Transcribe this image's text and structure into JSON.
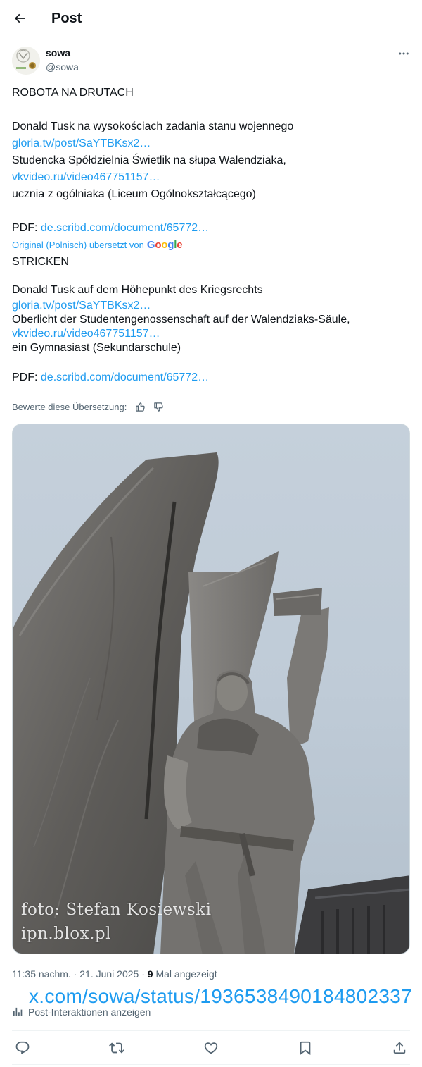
{
  "header": {
    "title": "Post"
  },
  "author": {
    "name": "sowa",
    "handle": "@sowa"
  },
  "post": {
    "original_title": "ROBOTA NA DRUTACH",
    "original_lines": [
      "Donald Tusk na wysokościach zadania stanu wojennego",
      "gloria.tv/post/SaYTBKsx2…",
      "Studencka Spółdzielnia Świetlik na słupa Walendziaka,",
      "vkvideo.ru/video467751157…",
      "ucznia z ogólniaka (Liceum Ogólnokształcącego)",
      "PDF: ",
      "de.scribd.com/document/65772…"
    ],
    "translated_by": "Original (Polnisch) übersetzt von",
    "google": [
      "G",
      "o",
      "o",
      "g",
      "l",
      "e"
    ],
    "translated_title": "STRICKEN",
    "translated_lines": [
      "Donald Tusk auf dem Höhepunkt des Kriegsrechts",
      "gloria.tv/post/SaYTBKsx2…",
      "Oberlicht der Studentengenossenschaft auf der Walendziaks-Säule,",
      "vkvideo.ru/video467751157…",
      "ein Gymnasiast (Sekundarschule)",
      "PDF: ",
      "de.scribd.com/document/65772…"
    ],
    "rate_label": "Bewerte diese Übersetzung:"
  },
  "media": {
    "watermark_line1": "foto: Stefan Kosiewski",
    "watermark_line2": "ipn.blox.pl"
  },
  "meta": {
    "time": "11:35 nachm.",
    "separator": " · ",
    "date": "21. Juni 2025",
    "views_count": "9",
    "views_label": " Mal angezeigt"
  },
  "status_url": "x.com/sowa/status/1936538490184802337",
  "interactions_label": "Post-Interaktionen anzeigen",
  "colors": {
    "link": "#1d9bf0",
    "secondary_text": "#536471",
    "primary_text": "#0f1419",
    "divider": "#eff3f4"
  },
  "icons": [
    "back-arrow-icon",
    "more-icon",
    "thumbs-up-icon",
    "thumbs-down-icon",
    "reply-icon",
    "repost-icon",
    "like-icon",
    "bookmark-icon",
    "share-icon",
    "analytics-icon"
  ]
}
